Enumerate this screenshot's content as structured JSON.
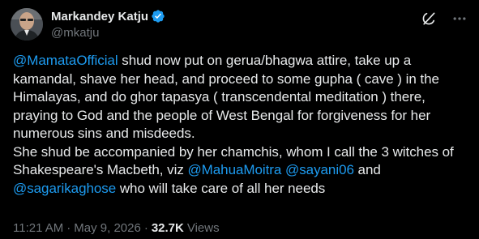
{
  "colors": {
    "background": "#000000",
    "text": "#e7e9ea",
    "secondary": "#71767b",
    "accent": "#1d9bf0"
  },
  "author": {
    "display_name": "Markandey Katju",
    "handle": "@mkatju",
    "verified": true,
    "avatar_icon": "avatar-photo"
  },
  "actions": {
    "grok_icon": "grok-icon",
    "more_icon": "more-icon"
  },
  "post": {
    "segments": [
      {
        "type": "mention",
        "text": "@MamataOfficial"
      },
      {
        "type": "text",
        "text": " shud now put on gerua/bhagwa attire, take up a kamandal, shave her head, and proceed to some gupha ( cave ) in the Himalayas, and do ghor tapasya ( transcendental meditation ) there, praying to God and the people of West Bengal for forgiveness for her numerous sins and misdeeds.\nShe shud be accompanied by her chamchis, whom I call the 3 witches of Shakespeare's Macbeth, viz "
      },
      {
        "type": "mention",
        "text": "@MahuaMoitra"
      },
      {
        "type": "text",
        "text": " "
      },
      {
        "type": "mention",
        "text": "@sayani06"
      },
      {
        "type": "text",
        "text": " and "
      },
      {
        "type": "mention",
        "text": "@sagarikaghose"
      },
      {
        "type": "text",
        "text": " who will take care of all her needs"
      }
    ]
  },
  "meta": {
    "time": "11:21 AM",
    "separator": "·",
    "date": "May 9, 2026",
    "views_count": "32.7K",
    "views_label": "Views"
  }
}
